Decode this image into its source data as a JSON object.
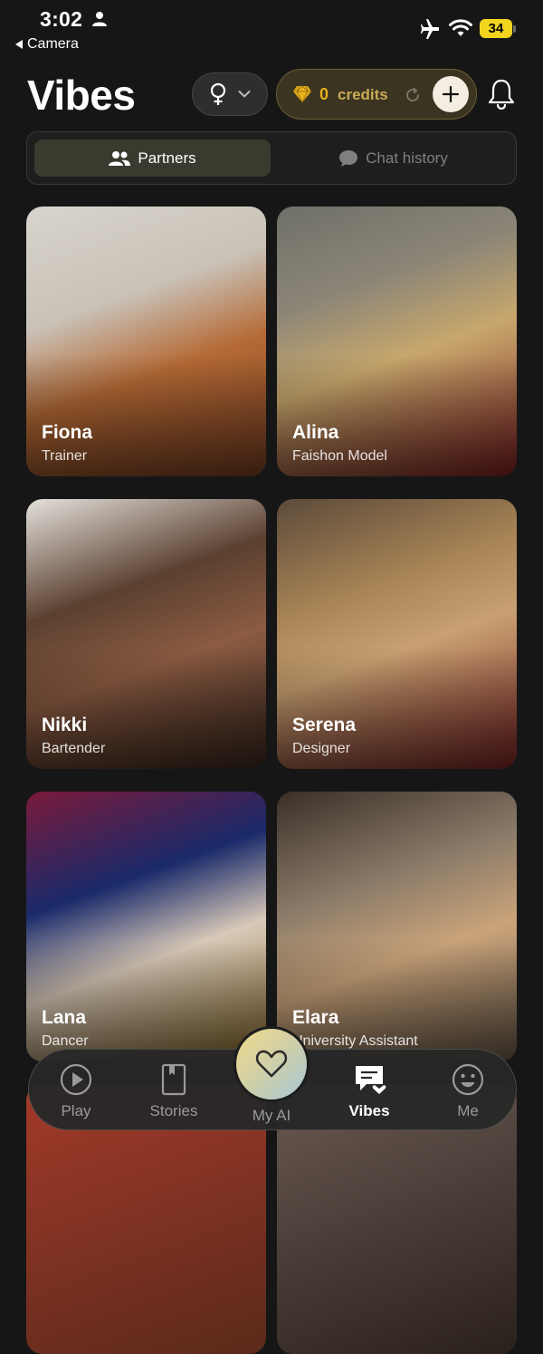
{
  "status_bar": {
    "time": "3:02",
    "back_app": "Camera",
    "battery": "34",
    "icons": [
      "person-icon",
      "airplane-icon",
      "wifi-icon",
      "battery-icon"
    ]
  },
  "header": {
    "title": "Vibes",
    "credits_amount": "0",
    "credits_label": "credits",
    "icons": [
      "female-icon",
      "chevron-down-icon",
      "gem-icon",
      "refresh-icon",
      "plus-icon",
      "bell-icon"
    ]
  },
  "tabs": {
    "partners": "Partners",
    "chat_history": "Chat history"
  },
  "cards": [
    {
      "name": "Fiona",
      "role": "Trainer"
    },
    {
      "name": "Alina",
      "role": "Faishon Model"
    },
    {
      "name": "Nikki",
      "role": "Bartender"
    },
    {
      "name": "Serena",
      "role": "Designer"
    },
    {
      "name": "Lana",
      "role": "Dancer"
    },
    {
      "name": "Elara",
      "role": "University Assistant"
    }
  ],
  "nav": {
    "play": "Play",
    "stories": "Stories",
    "my_ai": "My AI",
    "vibes": "Vibes",
    "me": "Me"
  },
  "colors": {
    "accent_gold": "#e8b21c",
    "battery": "#f2d41e",
    "background": "#161616"
  }
}
